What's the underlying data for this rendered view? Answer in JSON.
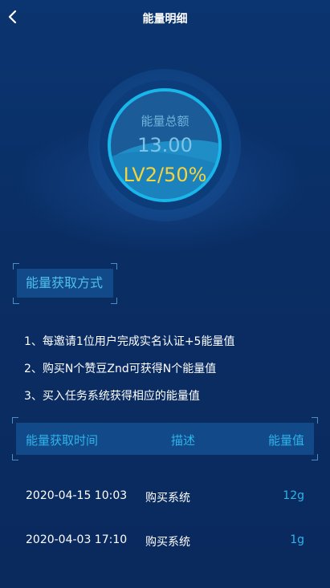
{
  "header": {
    "title": "能量明细",
    "back_icon": "chevron-left-icon"
  },
  "energy": {
    "label": "能量总额",
    "value": "13.00",
    "level": "LV2/50%",
    "colors": {
      "ring": "#19b6ea",
      "level": "#f4d33c"
    }
  },
  "methods": {
    "title": "能量获取方式",
    "rules": [
      "1、每邀请1位用户完成实名认证+5能量值",
      "2、购买N个赞豆Znd可获得N个能量值",
      "3、买入任务系统获得相应的能量值"
    ]
  },
  "table": {
    "headers": [
      "能量获取时间",
      "描述",
      "能量值"
    ],
    "rows": [
      {
        "time": "2020-04-15 10:03",
        "desc": "购买系统",
        "value": "12g"
      },
      {
        "time": "2020-04-03 17:10",
        "desc": "购买系统",
        "value": "1g"
      }
    ]
  },
  "colors": {
    "background": "#0a2a5e",
    "accent": "#2fb3ea",
    "panel": "#124a89"
  }
}
